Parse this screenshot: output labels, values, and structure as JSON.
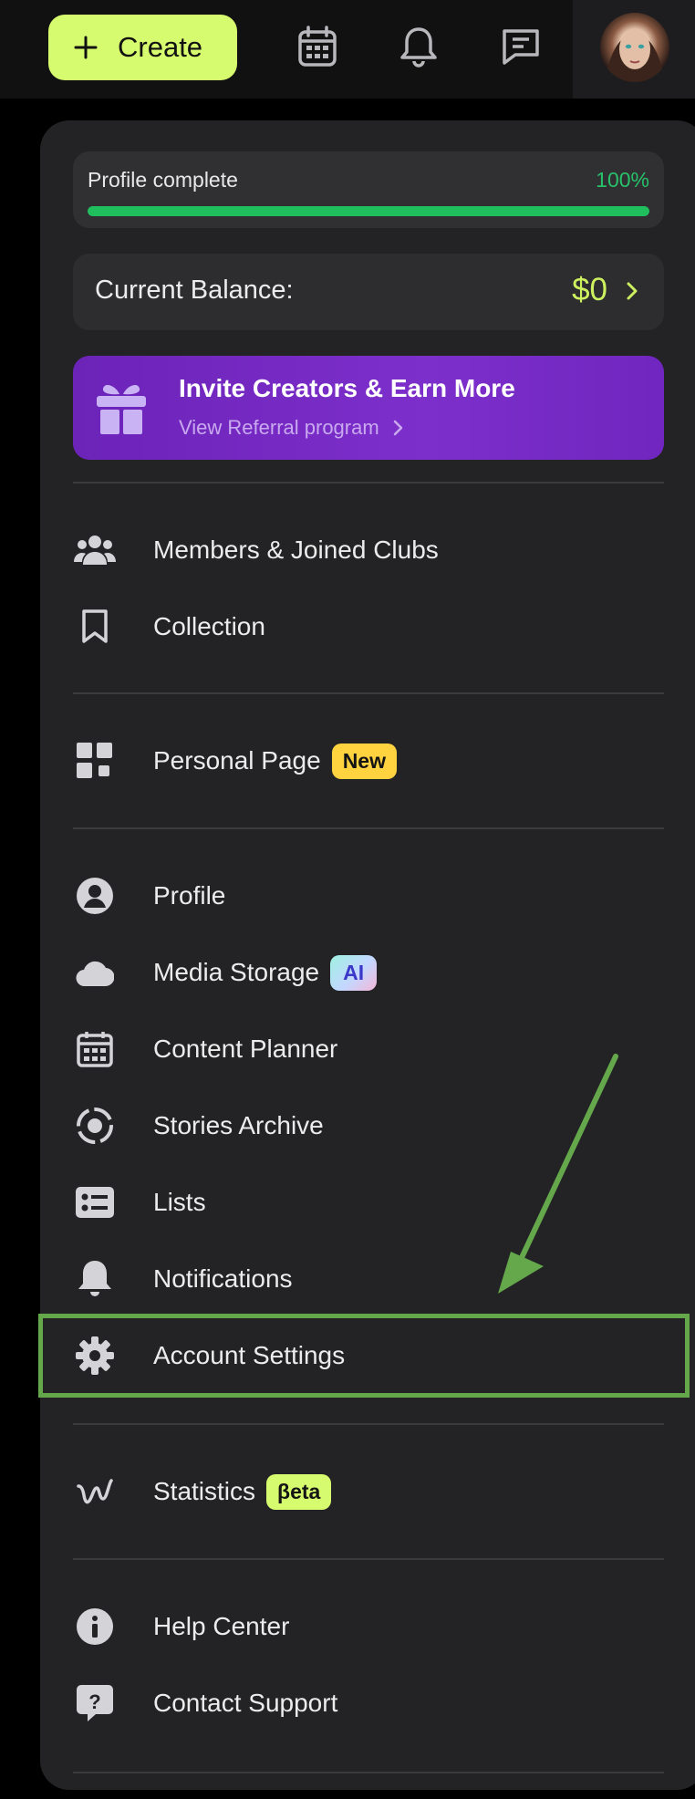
{
  "header": {
    "create_label": "Create",
    "icons": [
      "plus-icon",
      "calendar-icon",
      "bell-icon",
      "chat-icon",
      "avatar"
    ]
  },
  "profile_progress": {
    "label": "Profile complete",
    "percent_text": "100%",
    "percent": 100
  },
  "balance": {
    "label": "Current Balance:",
    "value": "$0"
  },
  "referral": {
    "title": "Invite Creators & Earn More",
    "subtitle": "View Referral program"
  },
  "menu": {
    "group1": [
      {
        "label": "Members & Joined Clubs",
        "icon": "people-icon"
      },
      {
        "label": "Collection",
        "icon": "bookmark-icon"
      }
    ],
    "personal_page": {
      "label": "Personal Page",
      "badge": "New",
      "icon": "grid-icon"
    },
    "group3": {
      "profile": {
        "label": "Profile",
        "icon": "user-circle-icon"
      },
      "media_storage": {
        "label": "Media Storage",
        "badge": "AI",
        "icon": "cloud-icon"
      },
      "content_planner": {
        "label": "Content Planner",
        "icon": "calendar-icon"
      },
      "stories_archive": {
        "label": "Stories Archive",
        "icon": "stories-icon"
      },
      "lists": {
        "label": "Lists",
        "icon": "list-icon"
      },
      "notifications": {
        "label": "Notifications",
        "icon": "bell-icon"
      },
      "account_settings": {
        "label": "Account Settings",
        "icon": "gear-icon"
      }
    },
    "statistics": {
      "label": "Statistics",
      "badge": "βeta",
      "icon": "stats-icon"
    },
    "help_center": {
      "label": "Help Center",
      "icon": "info-icon"
    },
    "contact_support": {
      "label": "Contact Support",
      "icon": "help-chat-icon"
    }
  },
  "colors": {
    "accent": "#d7fb6e",
    "panel": "#232325",
    "progress": "#1fbf5e",
    "referral": "#7326c2",
    "annotation": "#65a84c"
  }
}
